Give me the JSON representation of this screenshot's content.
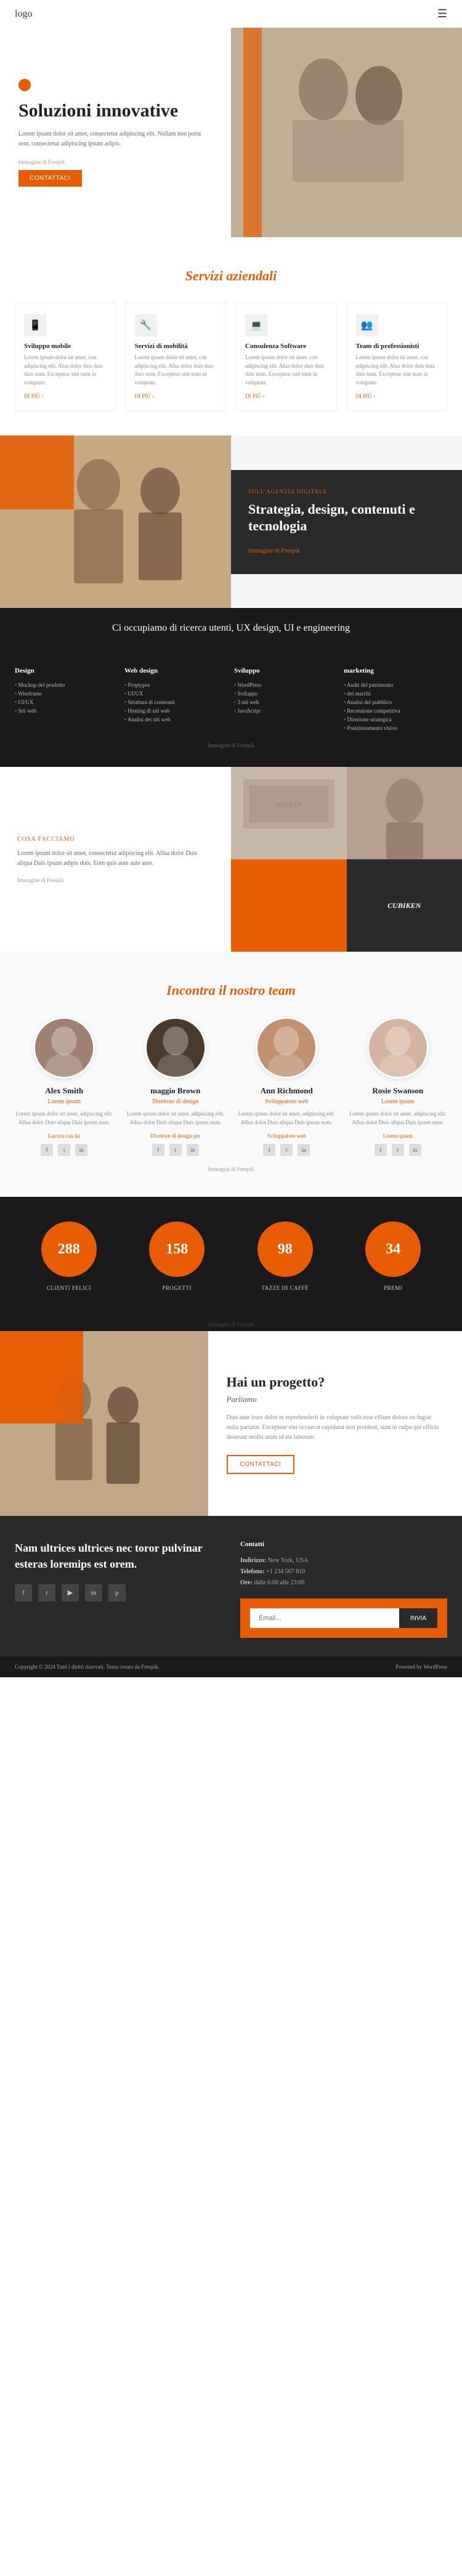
{
  "nav": {
    "logo": "logo",
    "menu_icon": "☰"
  },
  "hero": {
    "title": "Soluzioni innovative",
    "text": "Lorem ipsum dolor sit amet, consectetur adipiscing elit. Nullam non porta sem, consectetur adipiscing ipsum adipis.",
    "image_credit": "Immagine di Freepik",
    "cta_label": "CONTATTACI",
    "dot_color": "#e85d04"
  },
  "services": {
    "section_title": "Servizi aziendali",
    "cards": [
      {
        "icon": "📱",
        "name": "Sviluppo mobile",
        "desc": "Lorem ipsum dolor sit amet, con adipiscing elit. Alua dolor duis duis duis num. Excepteur sint num in voluptate.",
        "link": "DI PIÙ"
      },
      {
        "icon": "🔧",
        "name": "Servizi di mobilità",
        "desc": "Lorem ipsum dolor sit amet, con adipiscing elit. Alua dolor duis duis duis num. Excepteur sint num in voluptate.",
        "link": "DI PIÙ"
      },
      {
        "icon": "💻",
        "name": "Consulenza Software",
        "desc": "Lorem ipsum dolor sit amet, con adipiscing elit. Alua dolor duis duis duis num. Excepteur sint num in voluptate.",
        "link": "DI PIÙ"
      },
      {
        "icon": "👥",
        "name": "Team di professionisti",
        "desc": "Lorem ipsum dolor sit amet, con adipiscing elit. Alua dolor duis duis duis num. Excepteur sint num in voluptate.",
        "link": "DI PIÙ"
      }
    ]
  },
  "agency": {
    "label": "SULL'AGENZIA DIGITALE",
    "title": "Strategia, design, contenuti e tecnologia",
    "link": "Immagine di Freepik",
    "image_credit": "Immagine di Freepik"
  },
  "dark_band": {
    "text": "Ci occupiamo di ricerca utenti, UX design, UI e engineering"
  },
  "expertise": {
    "cols": [
      {
        "heading": "Design",
        "items": [
          "Mockup del prodotto",
          "Wireframe",
          "UI/UX",
          "Siti web"
        ]
      },
      {
        "heading": "Web design",
        "items": [
          "Proptypes",
          "UI/UX",
          "Struttura di contenuti",
          "Hosting di siti web",
          "Analisi dei siti web"
        ]
      },
      {
        "heading": "Sviluppo",
        "items": [
          "WordPress",
          "Sviluppo",
          "3 siti web",
          "JavaScript"
        ]
      },
      {
        "heading": "marketing",
        "items": [
          "Audit del patrimonio",
          "dei marchi",
          "Analisi del pubblico",
          "Recensione competitiva",
          "Direzione strategica",
          "Posizionamento visivo"
        ]
      }
    ],
    "credit": "Immagine di Freepik"
  },
  "what_we_do": {
    "label": "COSA FACCIAMO",
    "text": "Lorem ipsum dolor sit amet, consectetur adipiscing elit. Allua dolor Duis aliqua Duis ipsum adipis duis. Eum quis aute aute aute.",
    "credit": "Immagine di Freepik",
    "dark_brand": "CUBIKEN"
  },
  "team": {
    "section_title": "Incontra il nostro team",
    "credit": "Immagini di Freepik",
    "members": [
      {
        "name": "Alex Smith",
        "role": "Lorem ipsum",
        "desc": "Lorem ipsum dolor sit amet, adipiscing elit. Allua dolor Duis aliqua Duis ipsum num.",
        "link": "Lavora con lui",
        "socials": [
          "f",
          "t",
          "in"
        ]
      },
      {
        "name": "maggio Brown",
        "role": "Direttore di design",
        "desc": "Lorem ipsum dolor sit amet, adipiscing elit. Allua dolor Duis aliqua Duis ipsum num.",
        "link": "Direttore di design per",
        "socials": [
          "f",
          "t",
          "in"
        ]
      },
      {
        "name": "Ann Richmond",
        "role": "Sviluppatore web",
        "desc": "Lorem ipsum dolor sit amet, adipiscing elit. Allua dolor Duis aliqua Duis ipsum num.",
        "link": "Sviluppatore web",
        "socials": [
          "f",
          "t",
          "in"
        ]
      },
      {
        "name": "Rosie Swanson",
        "role": "Lorem ipsum",
        "desc": "Lorem ipsum dolor sit amet, adipiscing elit. Allua dolor Duis aliqua Duis ipsum num.",
        "link": "Lorem ipsum",
        "socials": [
          "f",
          "t",
          "in"
        ]
      }
    ]
  },
  "stats": {
    "credit": "Immagini di Freepik",
    "items": [
      {
        "number": "288",
        "label": "CLIENTI FELICI"
      },
      {
        "number": "158",
        "label": "PROGETTI"
      },
      {
        "number": "98",
        "label": "TAZZE DI CAFFÈ"
      },
      {
        "number": "34",
        "label": "PREMI"
      }
    ]
  },
  "cta": {
    "title": "Hai un progetto?",
    "subtitle": "Parliamo",
    "text": "Duis aute irure dolor in reprehenderit in voluptate velit esse cillum dolore eu fugiat nulla pariatur. Excepteur sint occaecat cupidatat non proident, sunt in culpa qui officia deserunt mollit anim id est laborum.",
    "btn_label": "CONTATTACI",
    "image_credit": "Immagine di Freepik"
  },
  "footer": {
    "tagline": "Nam ultrices ultrices nec toror pulvinar esteras loremips est orem.",
    "contact": {
      "title": "Contatti",
      "address_label": "Indirizzo:",
      "address": "New York, USA",
      "phone_label": "Telefono:",
      "phone": "+1 234 567 810",
      "email_label": "Ore:",
      "email": "dalle 6:00 alle 23:00"
    },
    "socials": [
      "f",
      "t",
      "📺",
      "in",
      "p"
    ],
    "newsletter_placeholder": "",
    "newsletter_btn": "INVIA",
    "bottom_text": "Copyright © 2024 Tutti i diritti riservati. Tema creato da Freepik.",
    "powered": "Powered by WordPress"
  }
}
